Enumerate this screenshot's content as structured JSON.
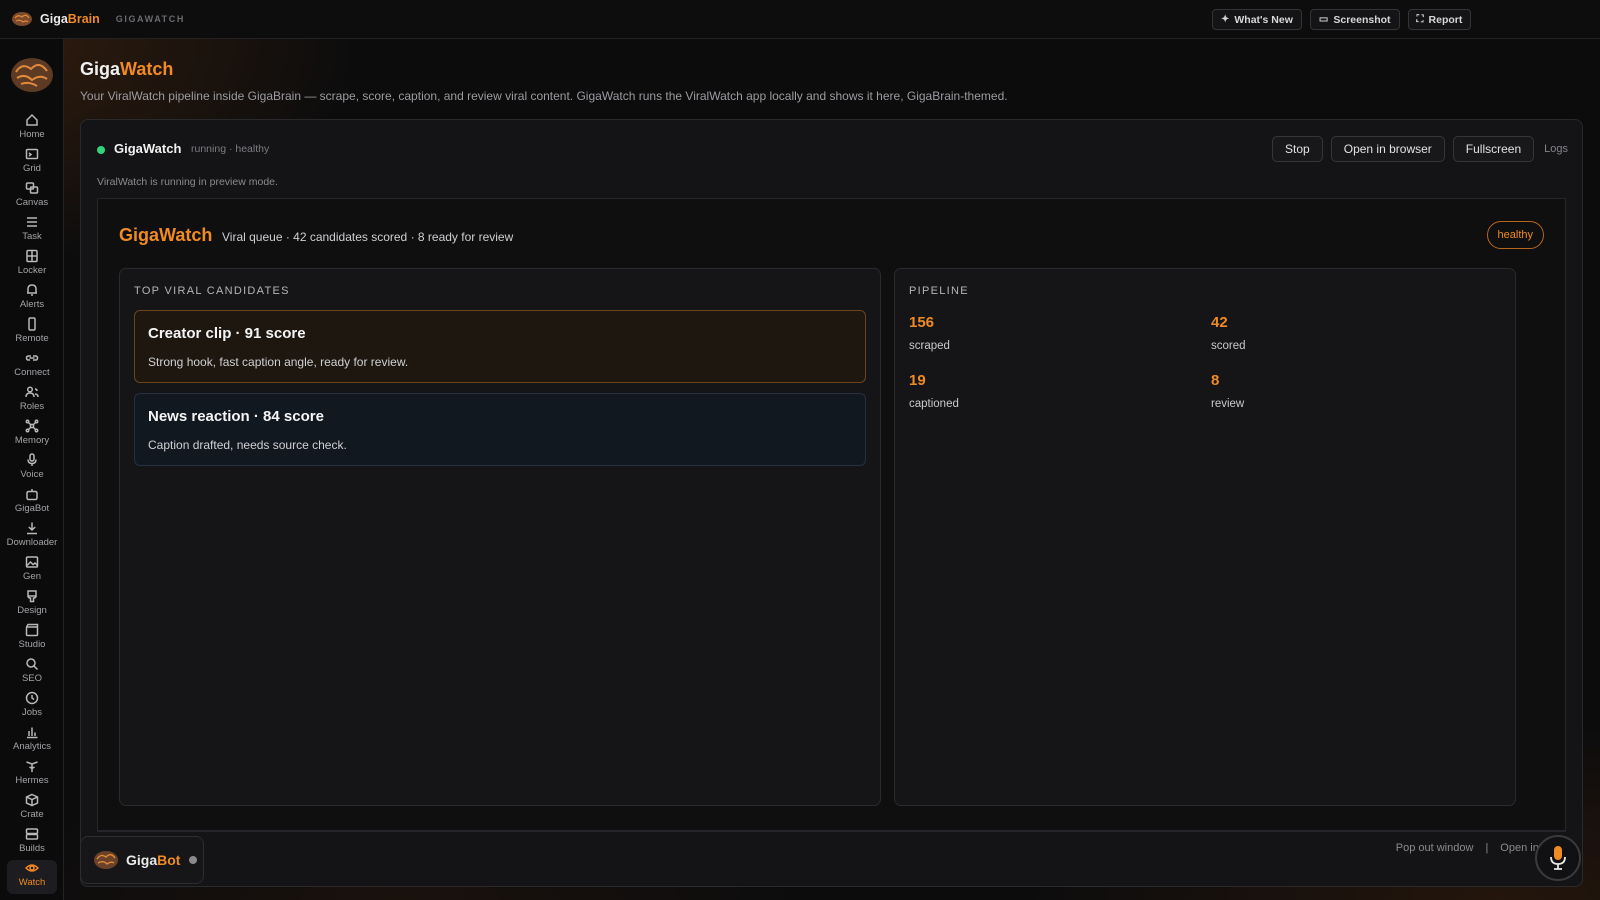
{
  "topbar": {
    "brand_prefix": "Giga",
    "brand_accent": "Brain",
    "section": "GIGAWATCH",
    "actions": [
      {
        "label": "What's New",
        "icon": "sparkle-icon"
      },
      {
        "label": "Screenshot",
        "icon": "camera-icon"
      },
      {
        "label": "Report",
        "icon": "expand-icon"
      }
    ]
  },
  "sidebar": {
    "items": [
      {
        "label": "Home",
        "icon": "home-icon"
      },
      {
        "label": "Grid",
        "icon": "terminal-icon"
      },
      {
        "label": "Canvas",
        "icon": "canvas-icon"
      },
      {
        "label": "Task",
        "icon": "list-icon"
      },
      {
        "label": "Locker",
        "icon": "locker-icon"
      },
      {
        "label": "Alerts",
        "icon": "bell-icon"
      },
      {
        "label": "Remote",
        "icon": "phone-icon"
      },
      {
        "label": "Connect",
        "icon": "link-icon"
      },
      {
        "label": "Roles",
        "icon": "users-icon"
      },
      {
        "label": "Memory",
        "icon": "network-icon"
      },
      {
        "label": "Voice",
        "icon": "mic-icon"
      },
      {
        "label": "GigaBot",
        "icon": "bot-icon"
      },
      {
        "label": "Downloader",
        "icon": "download-icon"
      },
      {
        "label": "Gen",
        "icon": "image-icon"
      },
      {
        "label": "Design",
        "icon": "brush-icon"
      },
      {
        "label": "Studio",
        "icon": "clapper-icon"
      },
      {
        "label": "SEO",
        "icon": "search-icon"
      },
      {
        "label": "Jobs",
        "icon": "clock-icon"
      },
      {
        "label": "Analytics",
        "icon": "bar-chart-icon"
      },
      {
        "label": "Hermes",
        "icon": "hermes-icon"
      },
      {
        "label": "Crate",
        "icon": "box-icon"
      },
      {
        "label": "Builds",
        "icon": "server-icon"
      },
      {
        "label": "Watch",
        "icon": "eye-icon",
        "active": true
      }
    ]
  },
  "page": {
    "title_prefix": "Giga",
    "title_accent": "Watch",
    "description": "Your ViralWatch pipeline inside GigaBrain — scrape, score, caption, and review viral content. GigaWatch runs the ViralWatch app locally and shows it here, GigaBrain-themed."
  },
  "panel": {
    "name": "GigaWatch",
    "status": "running · healthy",
    "status_color": "#34d27a",
    "actions": {
      "stop": "Stop",
      "open_browser": "Open in browser",
      "fullscreen": "Fullscreen",
      "logs": "Logs"
    },
    "preview_note": "ViralWatch is running in preview mode."
  },
  "app": {
    "title": "GigaWatch",
    "subtitle": "Viral queue · 42 candidates scored · 8 ready for review",
    "badge": "healthy",
    "candidates_heading": "TOP VIRAL CANDIDATES",
    "candidates": [
      {
        "title": "Creator clip · 91 score",
        "desc": "Strong hook, fast caption angle, ready for review."
      },
      {
        "title": "News reaction · 84 score",
        "desc": "Caption drafted, needs source check."
      }
    ],
    "pipeline_heading": "PIPELINE",
    "pipeline": [
      {
        "value": "156",
        "label": "scraped"
      },
      {
        "value": "42",
        "label": "scored"
      },
      {
        "value": "19",
        "label": "captioned"
      },
      {
        "value": "8",
        "label": "review"
      }
    ]
  },
  "footer": {
    "pop_out": "Pop out window",
    "separator": "|",
    "open_in": "Open in b"
  },
  "gigabot": {
    "prefix": "Giga",
    "accent": "Bot"
  },
  "colors": {
    "accent": "#f08a24",
    "background": "#0c0c0d"
  }
}
